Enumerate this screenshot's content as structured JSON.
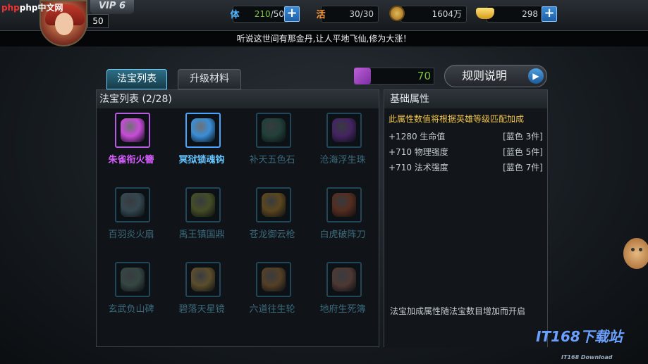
{
  "header": {
    "watermark": "php中文网",
    "vip": "VIP 6",
    "level": "50",
    "stamina": {
      "label": "体",
      "current": "210",
      "max": "/50"
    },
    "vitality": {
      "label": "活",
      "value": "30/30"
    },
    "copper": "1604万",
    "gold": "298",
    "ticker": "听说这世间有那金丹,让人平地飞仙,修为大涨！"
  },
  "tabs": [
    {
      "label": "法宝列表",
      "active": true
    },
    {
      "label": "升级材料",
      "active": false
    }
  ],
  "currency": {
    "value": "70",
    "icon": "purple-crystal-icon"
  },
  "rules_button": {
    "label": "规则说明"
  },
  "list": {
    "title": "法宝列表 (2/28)",
    "items": [
      {
        "name": "朱雀衔火簪",
        "state": "owned-purple",
        "color": "#c84cd8"
      },
      {
        "name": "冥狱锁魂钩",
        "state": "owned-blue",
        "color": "#3a8ed8"
      },
      {
        "name": "补天五色石",
        "state": "locked",
        "color": "#3d7a64"
      },
      {
        "name": "沧海浮生珠",
        "state": "locked",
        "color": "#8a3cc0"
      },
      {
        "name": "百羽炎火扇",
        "state": "locked",
        "color": "#6a8c9a"
      },
      {
        "name": "禹王镇国鼎",
        "state": "locked",
        "color": "#8a9a3a"
      },
      {
        "name": "苍龙御云枪",
        "state": "locked",
        "color": "#c08a2a"
      },
      {
        "name": "白虎破阵刀",
        "state": "locked",
        "color": "#b0502a"
      },
      {
        "name": "玄武负山碑",
        "state": "locked",
        "color": "#6a8a7a"
      },
      {
        "name": "碧落天星镜",
        "state": "locked",
        "color": "#c09a4a"
      },
      {
        "name": "六道往生轮",
        "state": "locked",
        "color": "#b07a3a"
      },
      {
        "name": "地府生死簿",
        "state": "locked",
        "color": "#a06a5a"
      }
    ]
  },
  "attributes": {
    "title": "基础属性",
    "note": "此属性数值将根据英雄等级匹配加成",
    "rows": [
      {
        "stat": "+1280 生命值",
        "req": "[蓝色 3件]"
      },
      {
        "stat": "+710 物理强度",
        "req": "[蓝色 5件]"
      },
      {
        "stat": "+710 法术强度",
        "req": "[蓝色 7件]"
      }
    ],
    "footer": "法宝加成属性随法宝数目增加而开启"
  },
  "site_watermark": {
    "main": "IT168下载站",
    "sub": "IT168 Download"
  }
}
